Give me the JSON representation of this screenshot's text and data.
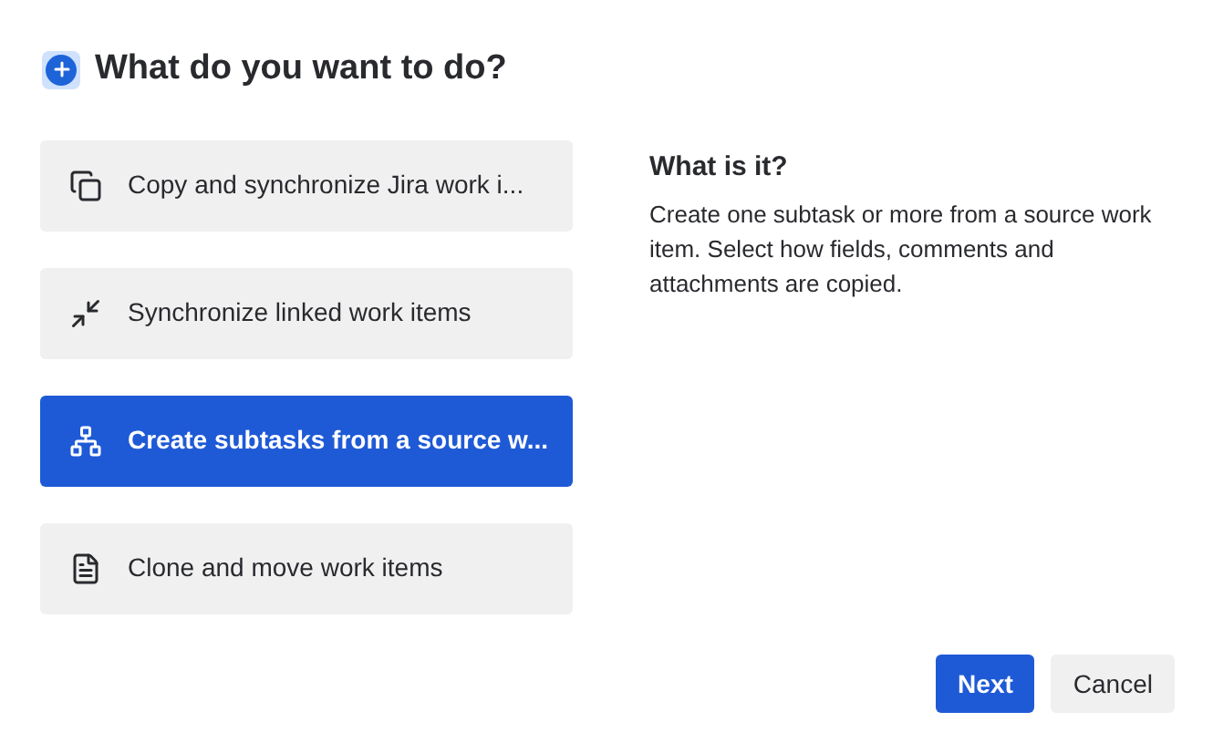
{
  "title": "What do you want to do?",
  "options": [
    {
      "kind": "copy",
      "label": "Copy and synchronize Jira work i...",
      "selected": false
    },
    {
      "kind": "sync",
      "label": "Synchronize linked work items",
      "selected": false
    },
    {
      "kind": "hierarchy",
      "label": "Create subtasks from a source w...",
      "selected": true
    },
    {
      "kind": "document",
      "label": "Clone and move work items",
      "selected": false
    }
  ],
  "details": {
    "title": "What is it?",
    "description": "Create one subtask or more from a source work item. Select how fields, comments and attachments are copied."
  },
  "buttons": [
    {
      "kind": "primary",
      "label": "Next"
    },
    {
      "kind": "secondary",
      "label": "Cancel"
    }
  ]
}
